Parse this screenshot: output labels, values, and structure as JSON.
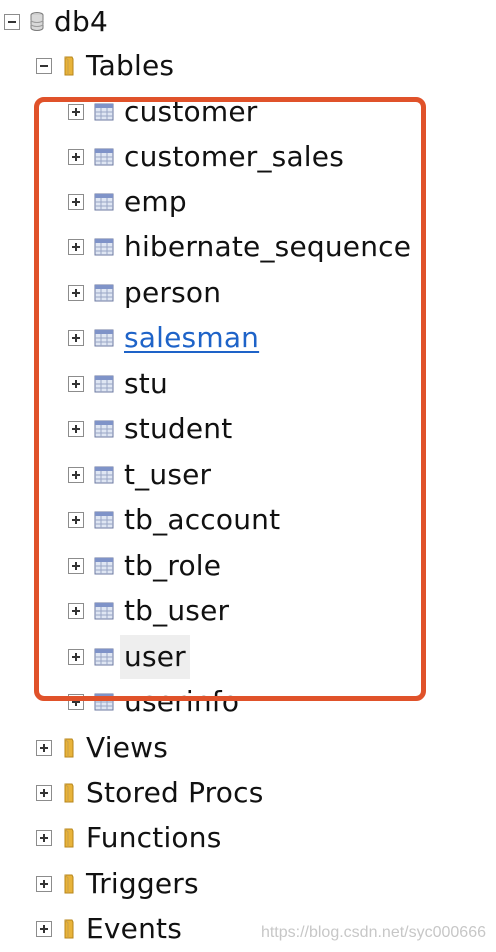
{
  "tree": {
    "database": {
      "label": "db4",
      "icon": "database-icon"
    },
    "tables_folder": {
      "label": "Tables",
      "icon": "folder-icon"
    },
    "tables": [
      {
        "label": "customer"
      },
      {
        "label": "customer_sales"
      },
      {
        "label": "emp"
      },
      {
        "label": "hibernate_sequence"
      },
      {
        "label": "person"
      },
      {
        "label": "salesman"
      },
      {
        "label": "stu"
      },
      {
        "label": "student"
      },
      {
        "label": "t_user"
      },
      {
        "label": "tb_account"
      },
      {
        "label": "tb_role"
      },
      {
        "label": "tb_user"
      },
      {
        "label": "user"
      },
      {
        "label": "userinfo"
      }
    ],
    "folders": [
      {
        "label": "Views"
      },
      {
        "label": "Stored Procs"
      },
      {
        "label": "Functions"
      },
      {
        "label": "Triggers"
      },
      {
        "label": "Events"
      }
    ]
  },
  "highlight": {
    "color": "#e0522a"
  },
  "link_color": "#1e63c8",
  "watermark": "https://blog.csdn.net/syc000666"
}
